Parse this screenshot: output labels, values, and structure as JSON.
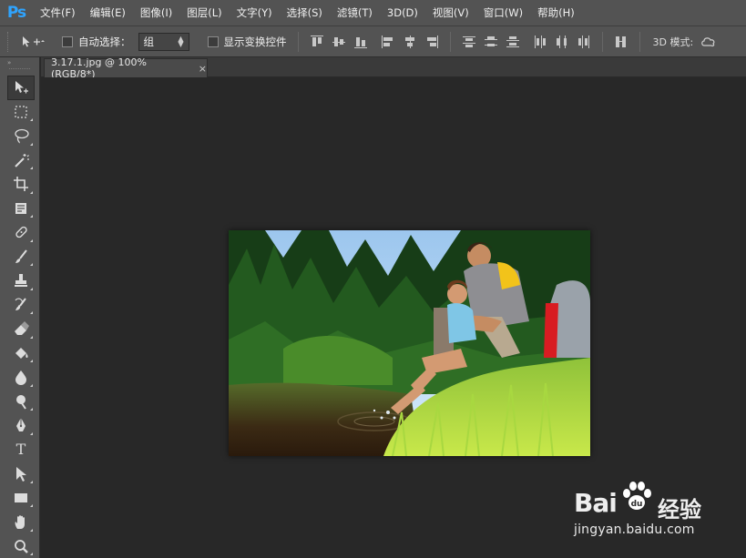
{
  "app": {
    "logo": "Ps"
  },
  "menu": [
    "文件(F)",
    "编辑(E)",
    "图像(I)",
    "图层(L)",
    "文字(Y)",
    "选择(S)",
    "滤镜(T)",
    "3D(D)",
    "视图(V)",
    "窗口(W)",
    "帮助(H)"
  ],
  "options": {
    "auto_select_label": "自动选择：",
    "auto_select_value": "组",
    "show_transform_label": "显示变换控件",
    "mode_3d_label": "3D 模式:"
  },
  "toolbar": {
    "collapse": "»",
    "tools": [
      "move-tool",
      "marquee-tool",
      "lasso-tool",
      "magic-wand-tool",
      "crop-tool",
      "eyedropper-tool",
      "healing-brush-tool",
      "brush-tool",
      "clone-stamp-tool",
      "history-brush-tool",
      "eraser-tool",
      "paint-bucket-tool",
      "blur-tool",
      "dodge-tool",
      "pen-tool",
      "type-tool",
      "path-selection-tool",
      "rectangle-tool",
      "hand-tool",
      "zoom-tool"
    ],
    "type_glyph": "T"
  },
  "document": {
    "tab_title": "3.17.1.jpg @ 100%(RGB/8*)",
    "close_glyph": "×"
  },
  "watermark": {
    "brand_left": "Bai",
    "brand_cn": "经验",
    "url": "jingyan.baidu.com"
  },
  "colors": {
    "ui_panel": "#535353",
    "canvas_bg": "#282828",
    "ps_blue": "#2fa4ff"
  }
}
